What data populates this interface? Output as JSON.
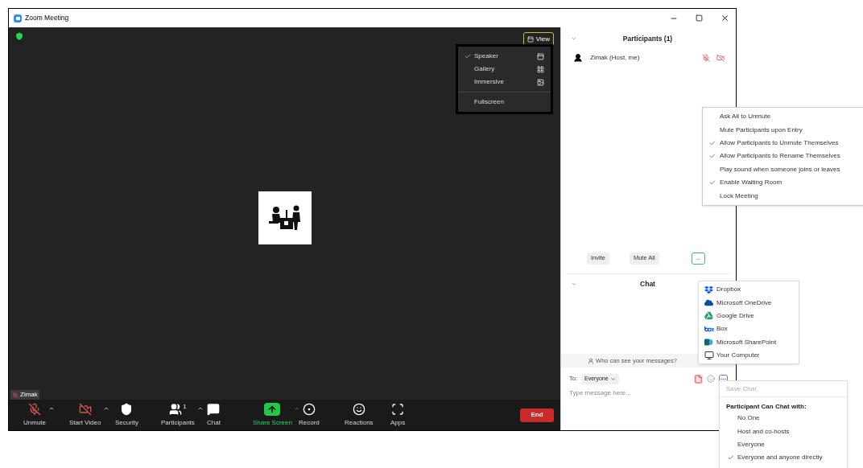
{
  "window": {
    "title": "Zoom Meeting"
  },
  "view_button": {
    "label": "View"
  },
  "view_menu": {
    "items": [
      {
        "label": "Speaker",
        "selected": true,
        "kind": "speaker"
      },
      {
        "label": "Gallery",
        "selected": false,
        "kind": "gallery"
      },
      {
        "label": "Immersive",
        "selected": false,
        "kind": "immersive"
      }
    ],
    "fullscreen": "Fullscreen"
  },
  "name_tag": {
    "name": "Zimak"
  },
  "toolbar": {
    "buttons": [
      {
        "label": "Unmute",
        "kind": "mic",
        "caret": true
      },
      {
        "label": "Start Video",
        "kind": "video",
        "caret": true
      },
      {
        "label": "Security",
        "kind": "security",
        "caret": false
      },
      {
        "label": "Participants",
        "kind": "participants",
        "caret": true,
        "count": "1"
      },
      {
        "label": "Chat",
        "kind": "chat",
        "caret": false
      },
      {
        "label": "Share Screen",
        "kind": "share",
        "caret": true
      },
      {
        "label": "Record",
        "kind": "record",
        "caret": false
      },
      {
        "label": "Reactions",
        "kind": "reactions",
        "caret": false
      },
      {
        "label": "Apps",
        "kind": "apps",
        "caret": false
      }
    ],
    "end": "End"
  },
  "participants": {
    "title": "Participants (1)",
    "list": [
      {
        "name": "Zimak (Host, me)"
      }
    ],
    "buttons": [
      "Invite",
      "Mute All"
    ],
    "more": "..."
  },
  "participants_menu": [
    {
      "label": "Ask All to Unmute",
      "checked": false
    },
    {
      "label": "Mute Participants upon Entry",
      "checked": false
    },
    {
      "label": "Allow Participants to Unmute Themselves",
      "checked": true
    },
    {
      "label": "Allow Participants to Rename Themselves",
      "checked": true
    },
    {
      "label": "Play sound when someone joins or leaves",
      "checked": false
    },
    {
      "label": "Enable Waiting Room",
      "checked": true
    },
    {
      "label": "Lock Meeting",
      "checked": false
    }
  ],
  "chat": {
    "title": "Chat",
    "notice": "Who can see your messages?",
    "to_label": "To:",
    "recipient": "Everyone",
    "placeholder": "Type message here..."
  },
  "file_menu": [
    {
      "label": "Dropbox",
      "kind": "dropbox"
    },
    {
      "label": "Microsoft OneDrive",
      "kind": "onedrive"
    },
    {
      "label": "Google Drive",
      "kind": "gdrive"
    },
    {
      "label": "Box",
      "kind": "box"
    },
    {
      "label": "Microsoft SharePoint",
      "kind": "sharepoint"
    },
    {
      "label": "Your Computer",
      "kind": "computer"
    }
  ],
  "chat_menu": {
    "save": {
      "label": "Save Chat",
      "disabled": true
    },
    "heading": "Participant Can Chat with:",
    "options": [
      {
        "label": "No One",
        "selected": false
      },
      {
        "label": "Host and co-hosts",
        "selected": false
      },
      {
        "label": "Everyone",
        "selected": false
      },
      {
        "label": "Everyone and anyone directly",
        "selected": true
      }
    ]
  }
}
